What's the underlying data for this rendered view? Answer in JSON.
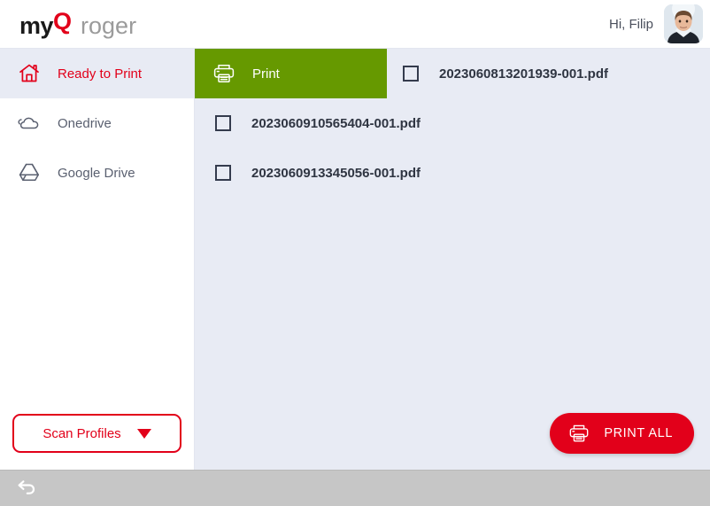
{
  "header": {
    "logo": {
      "part1": "my",
      "part2": "Q",
      "part3": "roger"
    },
    "greeting": "Hi, Filip",
    "avatar_name": "user-avatar"
  },
  "sidebar": {
    "items": [
      {
        "label": "Ready to Print",
        "icon": "home-icon",
        "active": true
      },
      {
        "label": "Onedrive",
        "icon": "cloud-icon",
        "active": false
      },
      {
        "label": "Google Drive",
        "icon": "google-drive-icon",
        "active": false
      }
    ],
    "scan_profiles": {
      "label": "Scan Profiles",
      "icon": "chevron-down-icon"
    }
  },
  "content": {
    "tab": {
      "label": "Print",
      "icon": "printer-icon"
    },
    "files": [
      {
        "name": "2023060813201939-001.pdf",
        "checked": false
      },
      {
        "name": "2023060910565404-001.pdf",
        "checked": false
      },
      {
        "name": "2023060913345056-001.pdf",
        "checked": false
      }
    ],
    "print_all": {
      "label": "PRINT ALL",
      "icon": "printer-icon"
    }
  },
  "bottom_bar": {
    "back": "back-arrow-icon"
  },
  "colors": {
    "brand_red": "#e2001a",
    "tab_green": "#669900",
    "content_bg": "#e8ebf4",
    "bottom_bar": "#c6c6c6",
    "text_dark": "#2f3542"
  }
}
